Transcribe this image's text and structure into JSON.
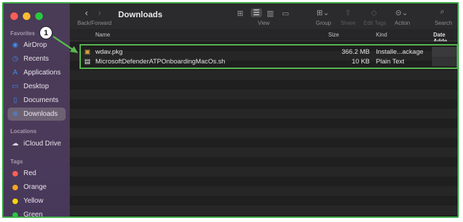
{
  "window": {
    "title": "Downloads"
  },
  "toolbar": {
    "back_forward_label": "Back/Forward",
    "view_label": "View",
    "group_label": "Group",
    "share_label": "Share",
    "edit_tags_label": "Edit Tags",
    "action_label": "Action",
    "search_label": "Search"
  },
  "sidebar": {
    "favorites_heading": "Favorites",
    "favorites": [
      {
        "label": "AirDrop",
        "icon": "airdrop-icon"
      },
      {
        "label": "Recents",
        "icon": "clock-icon"
      },
      {
        "label": "Applications",
        "icon": "applications-icon"
      },
      {
        "label": "Desktop",
        "icon": "desktop-icon"
      },
      {
        "label": "Documents",
        "icon": "document-icon"
      },
      {
        "label": "Downloads",
        "icon": "download-icon",
        "selected": true
      }
    ],
    "locations_heading": "Locations",
    "locations": [
      {
        "label": "iCloud Drive",
        "icon": "cloud-icon"
      }
    ],
    "tags_heading": "Tags",
    "tags": [
      {
        "label": "Red",
        "color": "#ff5f57"
      },
      {
        "label": "Orange",
        "color": "#f5a623"
      },
      {
        "label": "Yellow",
        "color": "#f8d30b"
      },
      {
        "label": "Green",
        "color": "#28c840"
      }
    ]
  },
  "columns": {
    "name": "Name",
    "size": "Size",
    "kind": "Kind",
    "date_added": "Date Adde"
  },
  "files": [
    {
      "name": "wdav.pkg",
      "size": "366.2 MB",
      "kind": "Installe...ackage",
      "icon": "package-icon"
    },
    {
      "name": "MicrosoftDefenderATPOnboardingMacOs.sh",
      "size": "10 KB",
      "kind": "Plain Text",
      "icon": "text-file-icon"
    }
  ],
  "callout": {
    "number": "1",
    "color": "#58b84f"
  }
}
